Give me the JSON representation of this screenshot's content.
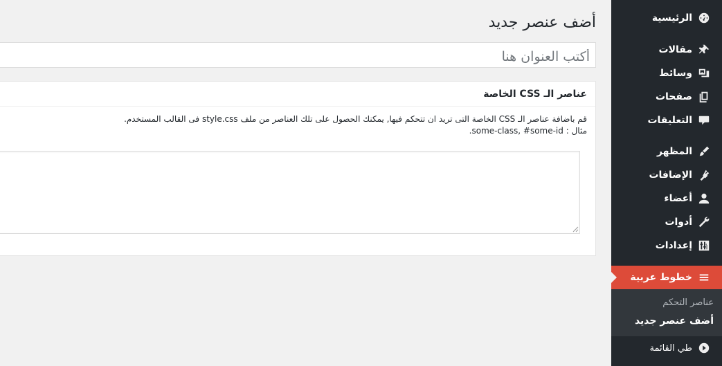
{
  "sidebar": {
    "items": [
      {
        "label": "الرئيسية",
        "icon": "dashboard-icon"
      },
      {
        "label": "مقالات",
        "icon": "pushpin-icon"
      },
      {
        "label": "وسائط",
        "icon": "media-icon"
      },
      {
        "label": "صفحات",
        "icon": "pages-icon"
      },
      {
        "label": "التعليقات",
        "icon": "comment-icon"
      },
      {
        "label": "المظهر",
        "icon": "paintbrush-icon"
      },
      {
        "label": "الإضافات",
        "icon": "plugin-icon"
      },
      {
        "label": "أعضاء",
        "icon": "user-icon"
      },
      {
        "label": "أدوات",
        "icon": "wrench-icon"
      },
      {
        "label": "إعدادات",
        "icon": "settings-icon"
      }
    ],
    "current": {
      "label": "خطوط عربية",
      "icon": "menu-lines-icon"
    },
    "submenu": {
      "items": [
        "عناصر التحكم",
        "أضف عنصر جديد"
      ],
      "active_index": 1
    },
    "collapse": {
      "label": "طي القائمة",
      "icon": "play-circle-icon"
    },
    "colors": {
      "background": "#23282d",
      "current": "#dd4b39",
      "submenu": "#32373c"
    }
  },
  "main": {
    "page_title": "أضف عنصر جديد",
    "title_placeholder": "أكتب العنوان هنا",
    "postbox": {
      "title": "عناصر الـ CSS الخاصة",
      "description": "قم باضافة عناصر الـ CSS الخاصة التى تريد ان تتحكم فيها, يمكنك الحصول على تلك العناصر من ملف style.css فى القالب المستخدم.",
      "example_label": "مثال :",
      "example_value": ".some-class, #some-id"
    }
  }
}
